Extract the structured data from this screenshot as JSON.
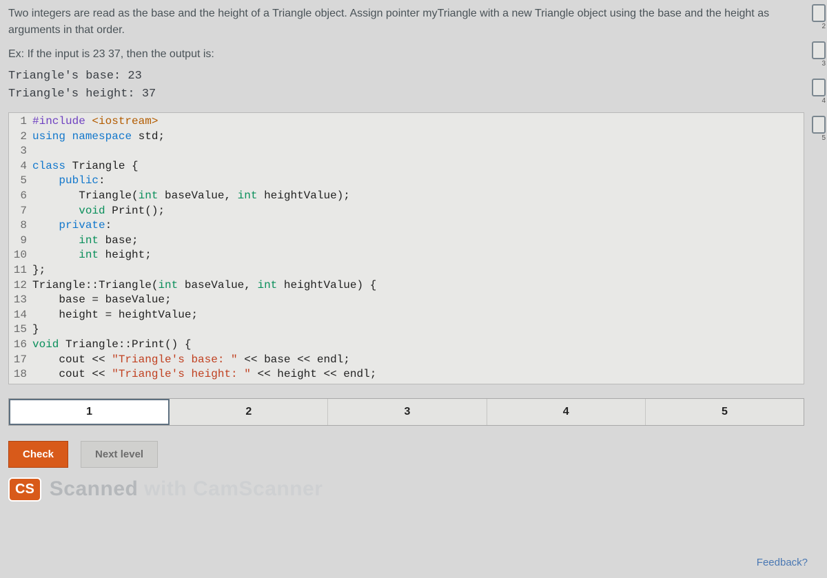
{
  "instructions": "Two integers are read as the base and the height of a Triangle object. Assign pointer myTriangle with a new Triangle object using the base and the height as arguments in that order.",
  "example_label": "Ex: If the input is 23  37, then the output is:",
  "example_output_line1": "Triangle's base: 23",
  "example_output_line2": "Triangle's height: 37",
  "code": {
    "l1_a": "#include",
    "l1_b": " <iostream>",
    "l2_a": "using",
    "l2_b": " ",
    "l2_c": "namespace",
    "l2_d": " std;",
    "l3": "",
    "l4_a": "class",
    "l4_b": " Triangle {",
    "l5_a": "    ",
    "l5_b": "public",
    "l5_c": ":",
    "l6_a": "       Triangle(",
    "l6_b": "int",
    "l6_c": " baseValue, ",
    "l6_d": "int",
    "l6_e": " heightValue);",
    "l7_a": "       ",
    "l7_b": "void",
    "l7_c": " Print();",
    "l8_a": "    ",
    "l8_b": "private",
    "l8_c": ":",
    "l9_a": "       ",
    "l9_b": "int",
    "l9_c": " base;",
    "l10_a": "       ",
    "l10_b": "int",
    "l10_c": " height;",
    "l11": "};",
    "l12_a": "Triangle::Triangle(",
    "l12_b": "int",
    "l12_c": " baseValue, ",
    "l12_d": "int",
    "l12_e": " heightValue) {",
    "l13": "    base = baseValue;",
    "l14": "    height = heightValue;",
    "l15": "}",
    "l16_a": "void",
    "l16_b": " Triangle::Print() {",
    "l17_a": "    cout << ",
    "l17_b": "\"Triangle's base: \"",
    "l17_c": " << base << endl;",
    "l18_a": "    cout << ",
    "l18_b": "\"Triangle's height: \"",
    "l18_c": " << height << endl;"
  },
  "line_numbers": [
    "1",
    "2",
    "3",
    "4",
    "5",
    "6",
    "7",
    "8",
    "9",
    "10",
    "11",
    "12",
    "13",
    "14",
    "15",
    "16",
    "17",
    "18"
  ],
  "progress": {
    "steps": [
      "1",
      "2",
      "3",
      "4",
      "5"
    ],
    "active": 0
  },
  "buttons": {
    "check": "Check",
    "next": "Next level"
  },
  "scanner": {
    "badge": "CS",
    "text_main": "Scanned",
    "text_faded": " with CamScanner"
  },
  "feedback_link": "Feedback?",
  "thumbs": [
    "2",
    "3",
    "4",
    "5"
  ]
}
